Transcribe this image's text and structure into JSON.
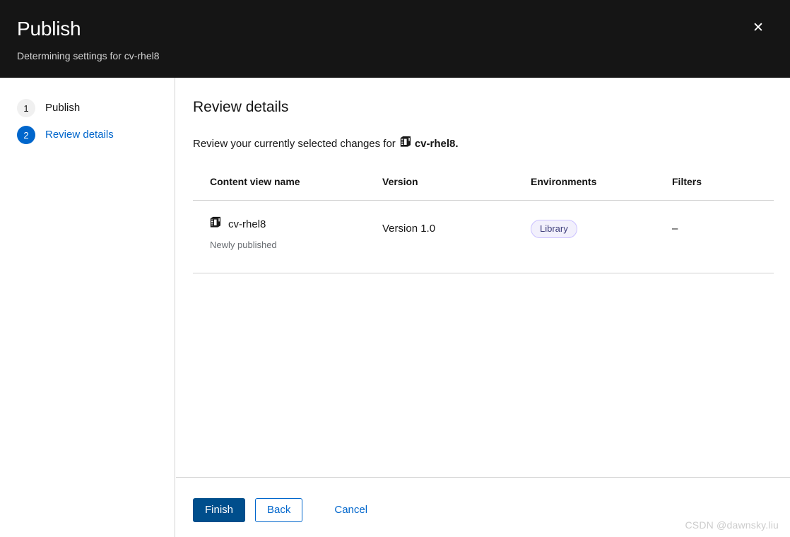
{
  "modal": {
    "title": "Publish",
    "subtitle": "Determining settings for cv-rhel8",
    "close_icon": "close-icon",
    "close_glyph": "✕"
  },
  "wizard_nav": {
    "steps": [
      {
        "number": "1",
        "label": "Publish",
        "state": "complete"
      },
      {
        "number": "2",
        "label": "Review details",
        "state": "current"
      }
    ]
  },
  "main": {
    "section_title": "Review details",
    "review_prefix": "Review your currently selected changes for",
    "review_target": "cv-rhel8.",
    "target_icon": "content-view-icon"
  },
  "table": {
    "columns": [
      "Content view name",
      "Version",
      "Environments",
      "Filters"
    ],
    "rows": [
      {
        "icon": "content-view-icon",
        "name": "cv-rhel8",
        "name_sub": "Newly published",
        "version": "Version 1.0",
        "environment": "Library",
        "filters": "–"
      }
    ]
  },
  "footer": {
    "finish_label": "Finish",
    "back_label": "Back",
    "cancel_label": "Cancel"
  },
  "watermark": {
    "text": "CSDN @dawnsky.liu"
  },
  "colors": {
    "header_bg": "#151515",
    "accent_blue": "#0066cc",
    "primary_button": "#004e8c",
    "label_bg": "#f2f0fc",
    "label_border": "#cbc1ff",
    "label_text": "#3d3d7a",
    "muted_text": "#6a6e73",
    "divider": "#d2d2d2"
  }
}
